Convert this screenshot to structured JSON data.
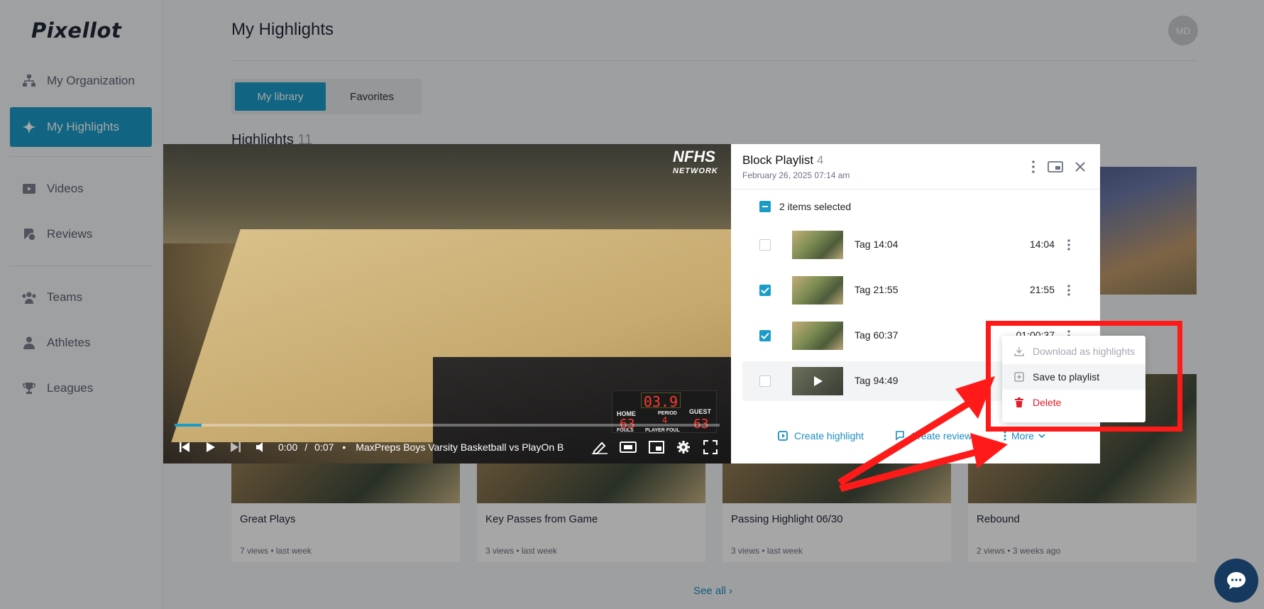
{
  "app": {
    "logo": "Pixellot",
    "user_initials": "MD"
  },
  "sidebar": {
    "items": [
      {
        "label": "My Organization",
        "icon": "org-icon"
      },
      {
        "label": "My Highlights",
        "icon": "sparkle-icon",
        "active": true
      },
      {
        "label": "Videos",
        "icon": "video-icon"
      },
      {
        "label": "Reviews",
        "icon": "reviews-icon"
      },
      {
        "label": "Teams",
        "icon": "teams-icon"
      },
      {
        "label": "Athletes",
        "icon": "athlete-icon"
      },
      {
        "label": "Leagues",
        "icon": "trophy-icon"
      }
    ]
  },
  "page": {
    "title": "My Highlights",
    "tabs": [
      {
        "label": "My library",
        "active": true
      },
      {
        "label": "Favorites",
        "active": false
      }
    ],
    "section_title": "Highlights",
    "section_count": "11",
    "cards": [
      {
        "title": "Great Plays",
        "meta": "7 views • last week"
      },
      {
        "title": "Key Passes from Game",
        "meta": "3 views • last week"
      },
      {
        "title": "Passing Highlight 06/30",
        "meta": "3 views • last week"
      },
      {
        "title": "Rebound",
        "meta": "2 views • 3 weeks ago"
      }
    ],
    "see_all": "See all"
  },
  "player": {
    "watermark_top": "NFHS",
    "watermark_bottom": "NETWORK",
    "scoreboard": {
      "clock": "03.9",
      "home_label": "HOME",
      "guest_label": "GUEST",
      "period_label": "PERIOD",
      "fouls_label": "FOULS",
      "player_foul_label": "PLAYER FOUL",
      "home_score": "63",
      "guest_score": "63",
      "period": "4"
    },
    "current_time": "0:00",
    "time_separator": "/",
    "duration": "0:07",
    "video_title": "MaxPreps Boys Varsity Basketball vs PlayOn B",
    "progress": 0.05
  },
  "playlist": {
    "title": "Block Playlist",
    "count": "4",
    "date": "February 26, 2025 07:14 am",
    "selected_text": "2 items selected",
    "items": [
      {
        "label": "Tag 14:04",
        "duration": "14:04",
        "checked": false
      },
      {
        "label": "Tag 21:55",
        "duration": "21:55",
        "checked": true
      },
      {
        "label": "Tag 60:37",
        "duration": "01:00:37",
        "checked": true
      },
      {
        "label": "Tag 94:49",
        "duration": "",
        "checked": false
      }
    ],
    "actions": {
      "create_highlight": "Create highlight",
      "create_review": "Create review",
      "more": "More"
    }
  },
  "menu": {
    "items": [
      {
        "label": "Download as highlights",
        "state": "disabled"
      },
      {
        "label": "Save to playlist",
        "state": "hover"
      },
      {
        "label": "Delete",
        "state": "danger"
      }
    ]
  },
  "colors": {
    "accent": "#1b9cc8",
    "danger": "#e11d2a",
    "annotation": "#ff1a1a"
  }
}
